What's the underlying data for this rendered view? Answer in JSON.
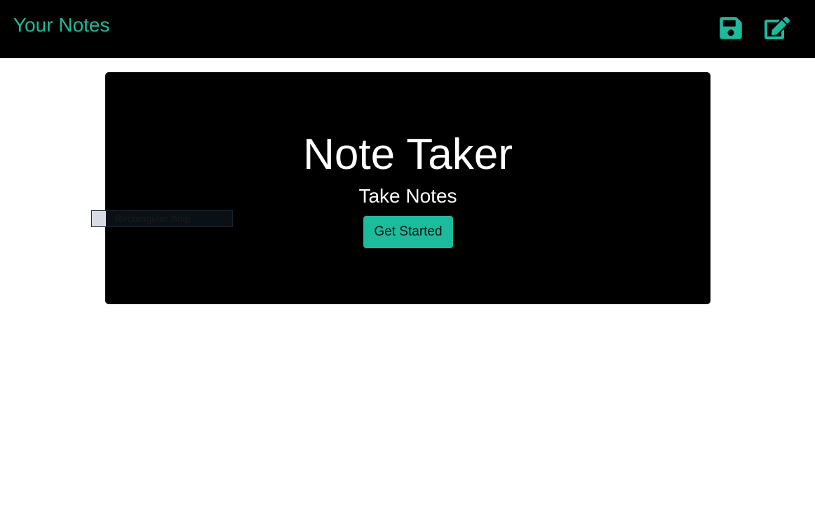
{
  "navbar": {
    "brand": "Your Notes",
    "icons": {
      "save": "save-icon",
      "new_note": "pen-to-square-icon"
    },
    "accent_color": "#1abc9c",
    "background": "#000000"
  },
  "hero": {
    "title": "Note Taker",
    "subtitle": "Take Notes",
    "button_label": "Get Started",
    "background": "#000000"
  },
  "overlay": {
    "snip_label": "Rectangular Snip"
  }
}
